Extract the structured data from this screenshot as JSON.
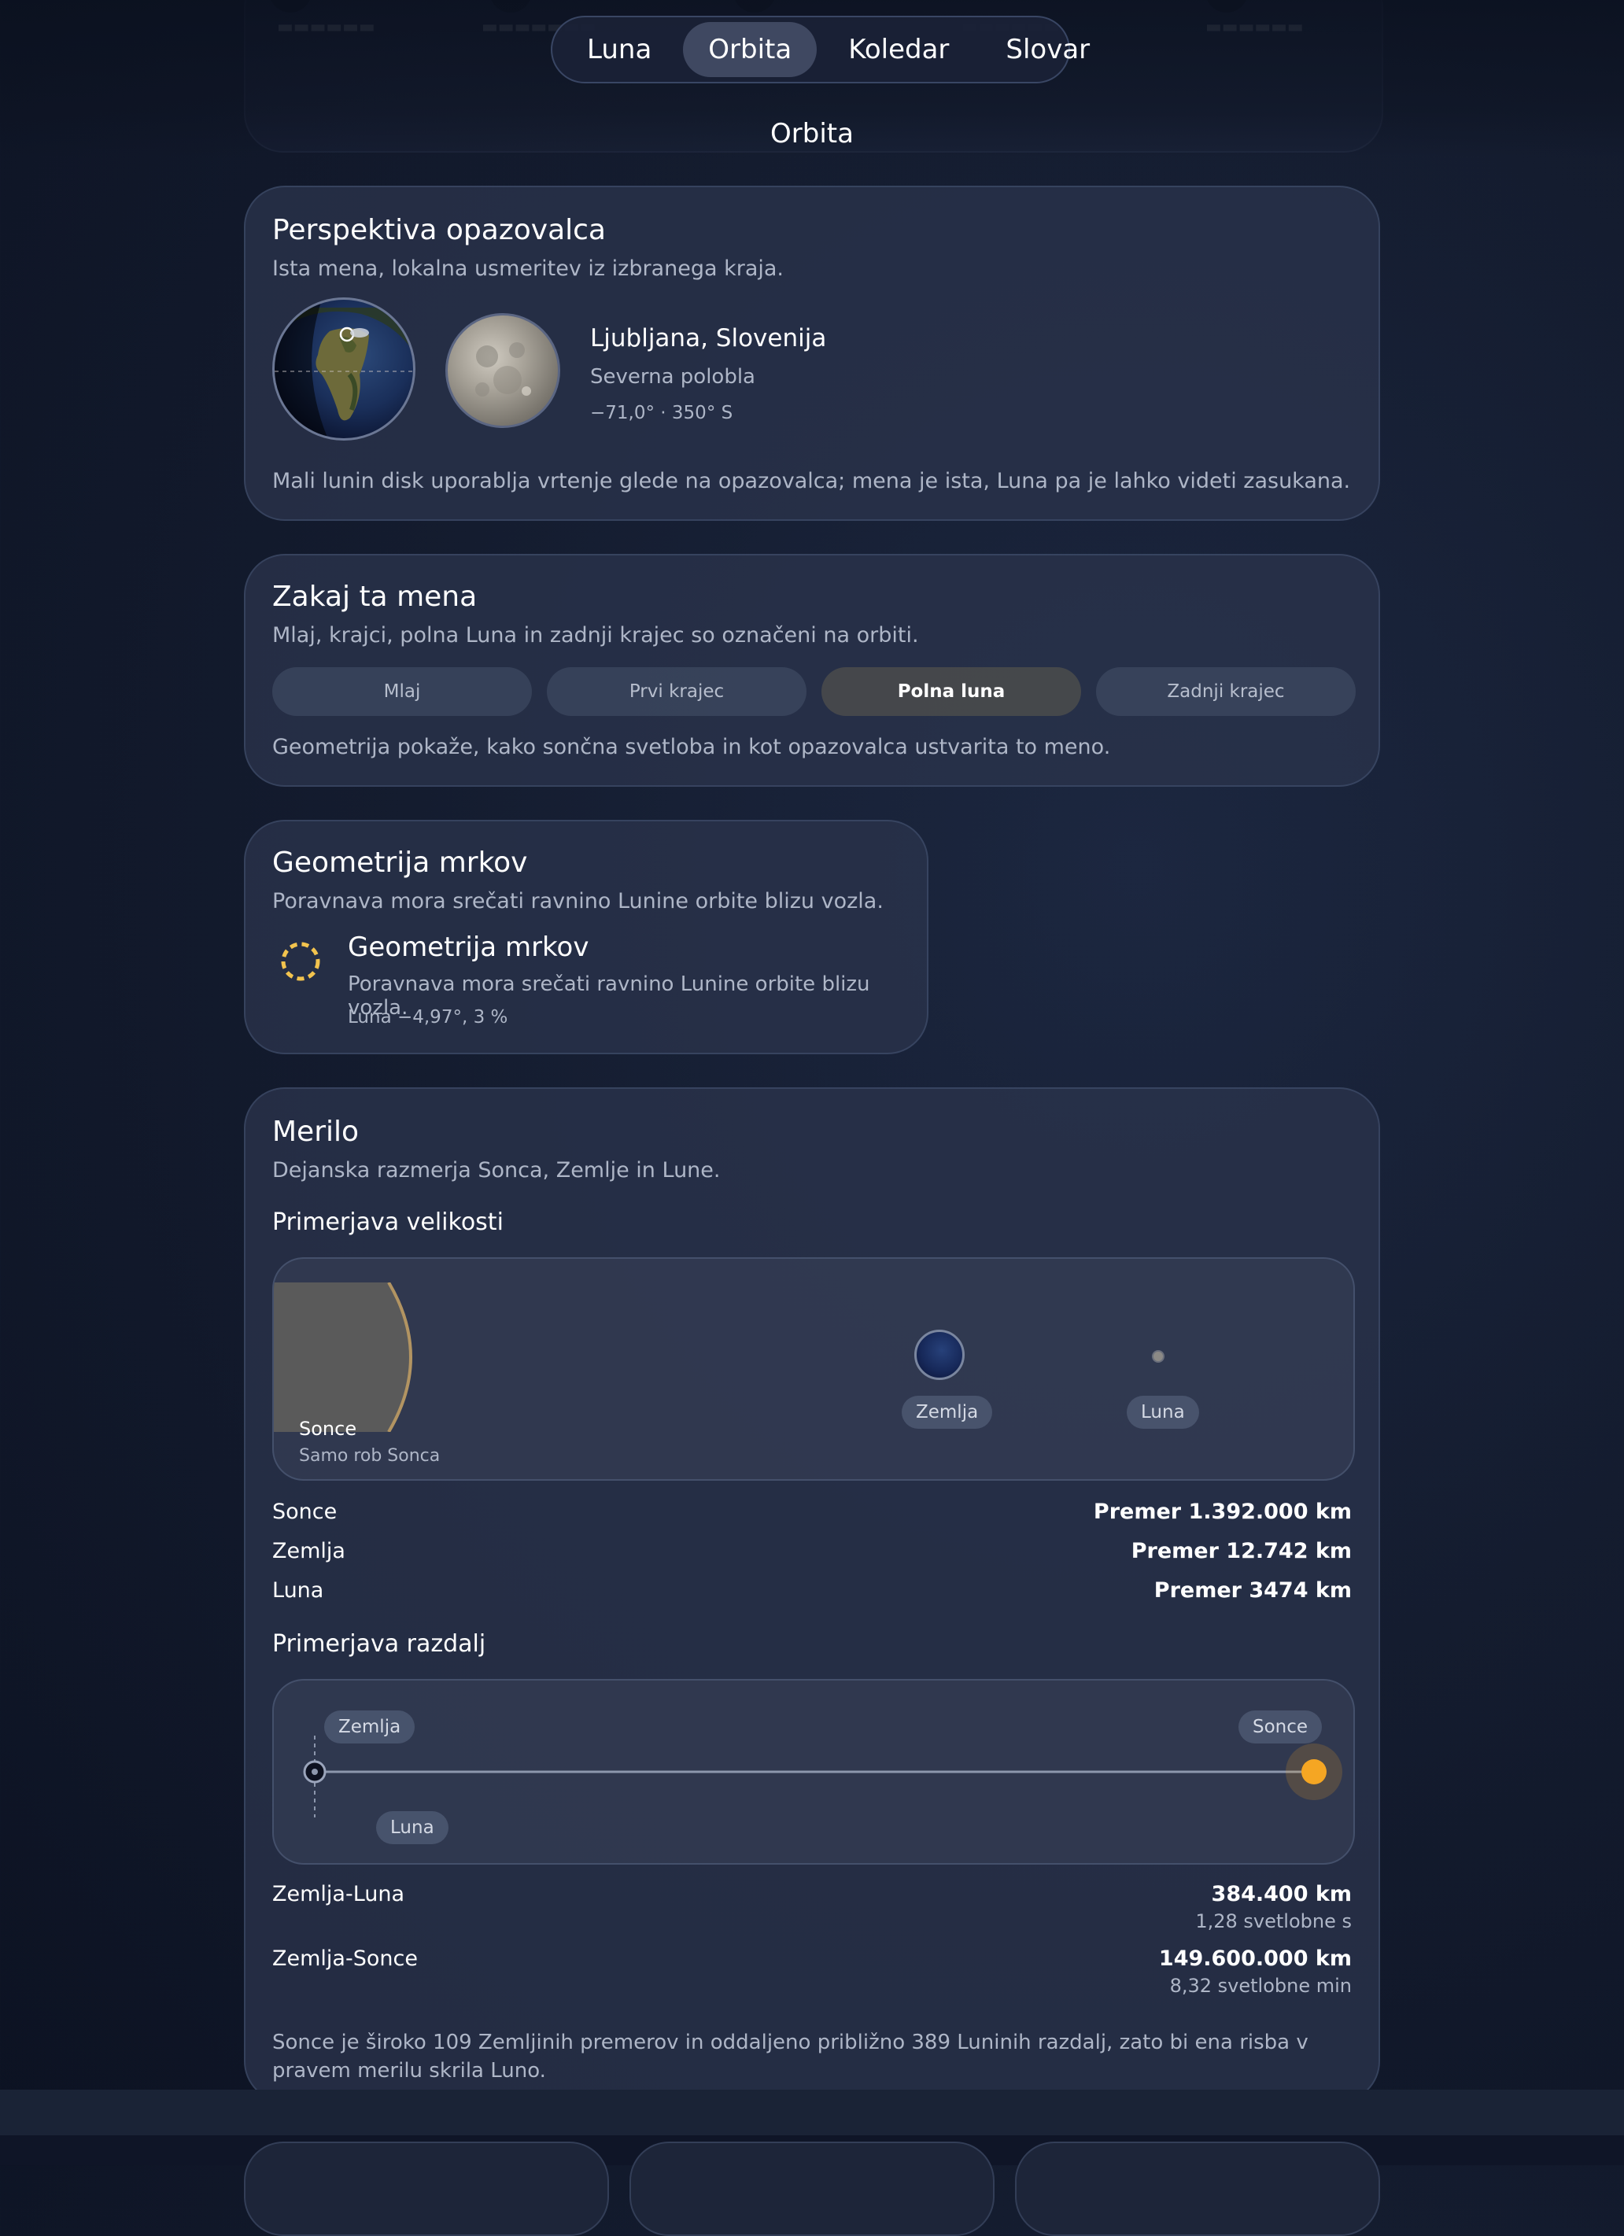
{
  "nav": {
    "tabs": [
      "Luna",
      "Orbita",
      "Koledar",
      "Slovar"
    ],
    "active": "Orbita"
  },
  "page_title": "Orbita",
  "observer": {
    "title": "Perspektiva opazovalca",
    "subtitle": "Ista mena, lokalna usmeritev iz izbranega kraja.",
    "location": "Ljubljana, Slovenija",
    "hemisphere": "Severna polobla",
    "coords": "−71,0° · 350° S",
    "note": "Mali lunin disk uporablja vrtenje glede na opazovalca; mena je ista, Luna pa je lahko videti zasukana."
  },
  "why": {
    "title": "Zakaj ta mena",
    "subtitle": "Mlaj, krajci, polna Luna in zadnji krajec so označeni na orbiti.",
    "phases": [
      "Mlaj",
      "Prvi krajec",
      "Polna luna",
      "Zadnji krajec"
    ],
    "selected_phase": "Polna luna",
    "note": "Geometrija pokaže, kako sončna svetloba in kot opazovalca ustvarita to meno."
  },
  "eclipse": {
    "title": "Geometrija mrkov",
    "subtitle": "Poravnava mora srečati ravnino Lunine orbite blizu vozla.",
    "item_title": "Geometrija mrkov",
    "item_desc": "Poravnava mora srečati ravnino Lunine orbite blizu vozla.",
    "item_value": "Luna −4,97°, 3 %",
    "icon": "dashed-ring-icon",
    "icon_color": "#f2c34e"
  },
  "scale": {
    "title": "Merilo",
    "subtitle": "Dejanska razmerja Sonca, Zemlje in Lune.",
    "size_heading": "Primerjava velikosti",
    "sun_label": "Sonce",
    "sun_caption": "Samo rob Sonca",
    "earth_label": "Zemlja",
    "moon_label": "Luna",
    "sizes": [
      {
        "name": "Sonce",
        "value": "Premer 1.392.000 km"
      },
      {
        "name": "Zemlja",
        "value": "Premer 12.742 km"
      },
      {
        "name": "Luna",
        "value": "Premer 3474 km"
      }
    ],
    "distance_heading": "Primerjava razdalj",
    "dist_labels": {
      "earth": "Zemlja",
      "sun": "Sonce",
      "moon": "Luna"
    },
    "distances": [
      {
        "name": "Zemlja-Luna",
        "value": "384.400 km",
        "sub": "1,28 svetlobne s"
      },
      {
        "name": "Zemlja-Sonce",
        "value": "149.600.000 km",
        "sub": "8,32 svetlobne min"
      }
    ],
    "note": "Sonce je široko 109 Zemljinih premerov in oddaljeno približno 389 Luninih razdalj, zato bi ena risba v pravem merilu skrila Luno."
  }
}
